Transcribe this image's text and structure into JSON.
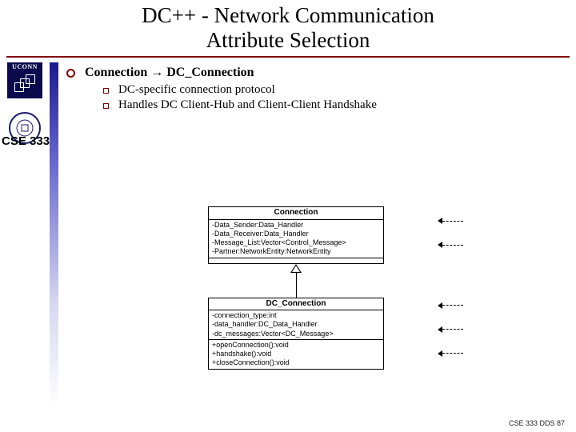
{
  "title": {
    "line1": "DC++ - Network Communication",
    "line2": "Attribute Selection"
  },
  "logo": {
    "text": "UCONN"
  },
  "course": "CSE 333",
  "bullet": {
    "heading": "Connection → DC_Connection",
    "subs": [
      "DC-specific connection protocol",
      "Handles DC Client-Hub and Client-Client Handshake"
    ]
  },
  "uml": {
    "parent": {
      "name": "Connection",
      "attrs": [
        "-Data_Sender:Data_Handler",
        "-Data_Receiver:Data_Handler",
        "-Message_List:Vector<Control_Message>",
        "-Partner:NetworkEntity:NetworkEntity"
      ]
    },
    "child": {
      "name": "DC_Connection",
      "attrs": [
        "-connection_type:int",
        "-data_handler:DC_Data_Handler",
        "-dc_messages:Vector<DC_Message>"
      ],
      "ops": [
        "+openConnection():void",
        "+handshake():void",
        "+closeConnection():void"
      ]
    }
  },
  "footer": "CSE 333 DDS 87"
}
